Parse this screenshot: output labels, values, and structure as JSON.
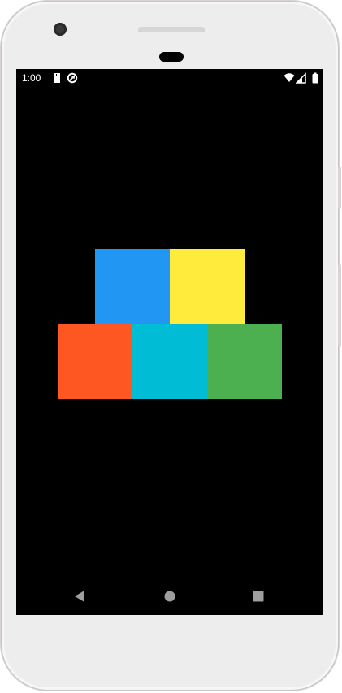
{
  "status_bar": {
    "time": "1:00",
    "left_icons": [
      "sd-card-icon",
      "sync-icon"
    ],
    "right_icons": [
      "wifi-icon",
      "cellular-signal-icon",
      "battery-icon"
    ]
  },
  "blocks": [
    {
      "name": "blue-block",
      "color": "#2196F3"
    },
    {
      "name": "yellow-block",
      "color": "#FFEB3B"
    },
    {
      "name": "orange-block",
      "color": "#FF5722"
    },
    {
      "name": "cyan-block",
      "color": "#00BCD4"
    },
    {
      "name": "green-block",
      "color": "#4CAF50"
    }
  ],
  "nav_bar": {
    "buttons": [
      "back-icon",
      "home-icon",
      "recents-icon"
    ],
    "color": "#9e9e9e"
  },
  "colors": {
    "screen_background": "#000000",
    "device_frame": "#EDEDED"
  }
}
